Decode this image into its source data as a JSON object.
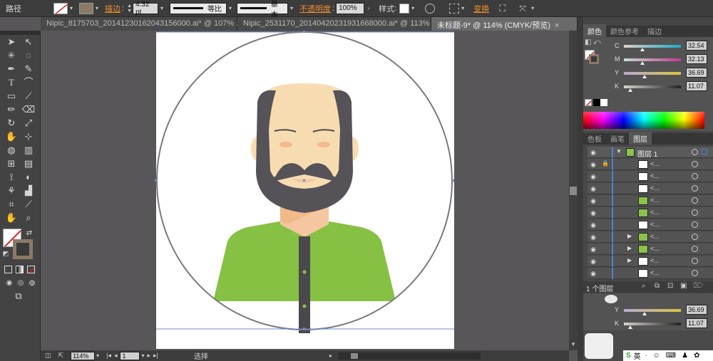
{
  "control_bar": {
    "path_label": "路径",
    "stroke_label": "描边",
    "stroke_value": "4.32 pt",
    "profile_label": "等比",
    "brush_label": "基本",
    "opacity_label": "不透明度",
    "opacity_value": "100%",
    "style_label": "样式",
    "transform_label": "变换"
  },
  "tabs": [
    {
      "label": "Nipic_8175703_20141230162043156000.ai* @ 107% ..."
    },
    {
      "label": "Nipic_2531170_20140420231931668000.ai* @ 113% ..."
    },
    {
      "label": "未标题-9* @ 114% (CMYK/预览)"
    }
  ],
  "status_bar": {
    "zoom": "114%",
    "page": "1",
    "tool_name": "选择"
  },
  "color_panel": {
    "tabs": [
      "颜色",
      "颜色参考",
      "描边"
    ],
    "channels": [
      {
        "letter": "C",
        "value": "32.54",
        "level": 0.3254
      },
      {
        "letter": "M",
        "value": "32.13",
        "level": 0.3213
      },
      {
        "letter": "Y",
        "value": "36.69",
        "level": 0.3669
      },
      {
        "letter": "K",
        "value": "11.07",
        "level": 0.1107
      }
    ],
    "colors": {
      "c_track": "#21a9c9",
      "m_track": "#c23a93",
      "y_track": "#d9c43b",
      "k_track": "#222222"
    }
  },
  "layers_panel": {
    "tabs": [
      "色板",
      "画笔",
      "图层"
    ],
    "layer_name": "图层 1",
    "sublayer_name": "<...",
    "count_label": "1 个图层",
    "rows": [
      {
        "thumb": "#ffffff",
        "lock": true,
        "expand": false
      },
      {
        "thumb": "#ffffff",
        "lock": false,
        "expand": false
      },
      {
        "thumb": "#ffffff",
        "lock": false,
        "expand": false
      },
      {
        "thumb": "#8bc34a",
        "lock": false,
        "expand": false
      },
      {
        "thumb": "#8bc34a",
        "lock": false,
        "expand": false
      },
      {
        "thumb": "#ffffff",
        "lock": false,
        "expand": false
      },
      {
        "thumb": "#8bc34a",
        "lock": false,
        "expand": true
      },
      {
        "thumb": "#8bc34a",
        "lock": false,
        "expand": true
      },
      {
        "thumb": "#ffffff",
        "lock": false,
        "expand": true
      },
      {
        "thumb": "#ffffff",
        "lock": false,
        "expand": false
      }
    ]
  },
  "lower_panel": {
    "channels": [
      {
        "letter": "Y",
        "value": "36.69",
        "level": 0.3669
      },
      {
        "letter": "K",
        "value": "11.07",
        "level": 0.1107
      }
    ]
  },
  "ime": {
    "lang": "英"
  },
  "artwork_colors": {
    "skin": "#f8dcb1",
    "hair": "#555358",
    "shirt": "#86c143",
    "neck": "#f4c7a0",
    "placket": "#4a484c",
    "button": "#8bc34a",
    "circle": "#7a787c"
  }
}
